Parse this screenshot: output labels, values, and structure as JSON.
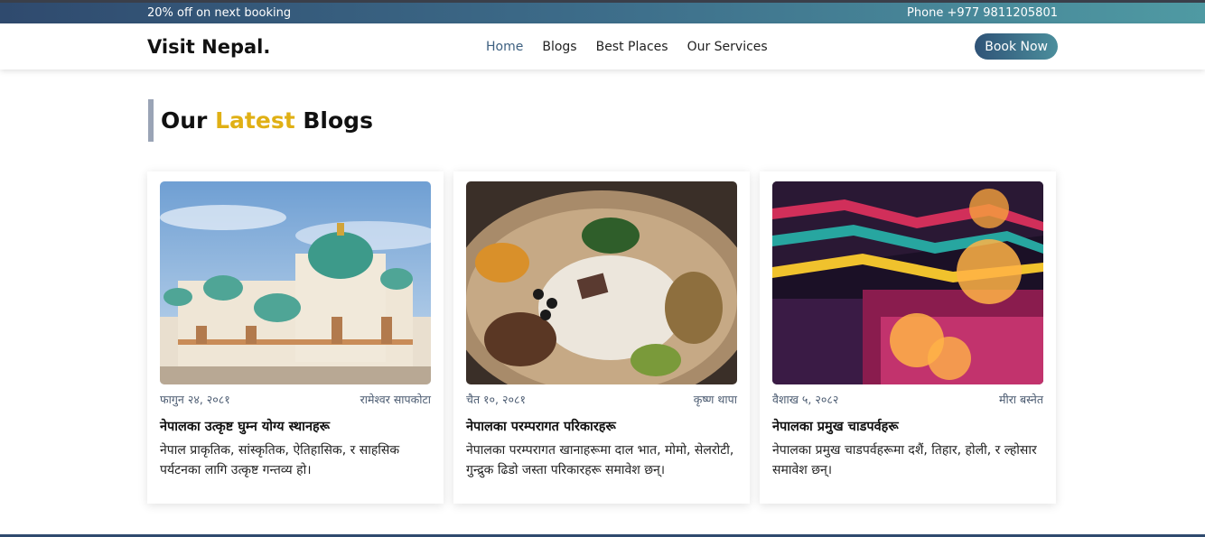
{
  "topbar": {
    "promo": "20% off on next booking",
    "phone": "Phone +977 9811205801"
  },
  "navbar": {
    "brand": "Visit Nepal.",
    "links": [
      {
        "label": "Home",
        "active": true
      },
      {
        "label": "Blogs"
      },
      {
        "label": "Best Places"
      },
      {
        "label": "Our Services"
      }
    ],
    "cta": "Book Now"
  },
  "section": {
    "title_prefix": "Our",
    "title_accent": "Latest",
    "title_suffix": "Blogs"
  },
  "colors": {
    "accent": "#e0b015",
    "brand_dark": "#2f4a6e",
    "brand_teal": "#4f9aa3"
  },
  "blogs": [
    {
      "image": "temple-photo",
      "date": "फागुन २४, २०८१",
      "author": "रामेश्वर सापकोटा",
      "title": "नेपालका उत्कृष्ट घुम्न योग्य स्थानहरू",
      "desc": "नेपाल प्राकृतिक, सांस्कृतिक, ऐतिहासिक, र साहसिक पर्यटनका लागि उत्कृष्ट गन्तव्य हो।"
    },
    {
      "image": "food-platter-photo",
      "date": "चैत १०, २०८१",
      "author": "कृष्ण थापा",
      "title": "नेपालका परम्परागत परिकारहरू",
      "desc": "नेपालका परम्परागत खानाहरूमा दाल भात, मोमो, सेलरोटी, गुन्द्रुक ढिडो जस्ता परिकारहरू समावेश छन्।"
    },
    {
      "image": "festival-lights-photo",
      "date": "वैशाख ५, २०८२",
      "author": "मीरा बस्नेत",
      "title": "नेपालका प्रमुख चाडपर्वहरू",
      "desc": "नेपालका प्रमुख चाडपर्वहरूमा दशैं, तिहार, होली, र ल्होसार समावेश छन्।"
    }
  ]
}
